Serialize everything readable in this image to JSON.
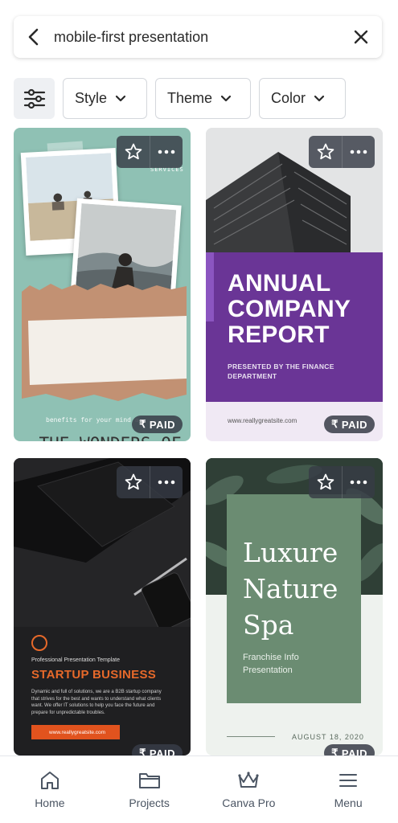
{
  "search": {
    "query": "mobile-first presentation"
  },
  "filters": {
    "chips": [
      {
        "label": "Style"
      },
      {
        "label": "Theme"
      },
      {
        "label": "Color"
      }
    ]
  },
  "templates": [
    {
      "title": "THE WONDERS OF MEDITATION",
      "subtitle": "benefits for your mind a",
      "corner_text": "SERVICES",
      "badge": "PAID",
      "currency": "₹",
      "bg_color": "#8fc1b4"
    },
    {
      "title_lines": [
        "ANNUAL",
        "COMPANY",
        "REPORT"
      ],
      "subtitle": "PRESENTED BY THE FINANCE DEPARTMENT",
      "site": "www.reallygreatsite.com",
      "badge": "PAID",
      "currency": "₹",
      "accent_color": "#6a3596"
    },
    {
      "kicker": "Professional Presentation Template",
      "title": "STARTUP BUSINESS",
      "body": "Dynamic and full of solutions, we are a B2B startup company that strives for the best and wants to understand what clients want. We offer IT solutions to help you face the future and prepare for unpredictable troubles.",
      "button_text": "www.reallygreatsite.com",
      "badge": "PAID",
      "currency": "₹",
      "accent_color": "#e6692a"
    },
    {
      "title_lines": [
        "Luxure",
        "Nature",
        "Spa"
      ],
      "subtitle_lines": [
        "Franchise Info",
        "Presentation"
      ],
      "date": "AUGUST 18, 2020",
      "badge": "PAID",
      "currency": "₹",
      "accent_color": "#6b8c72"
    }
  ],
  "bottom_nav": {
    "items": [
      {
        "label": "Home",
        "icon": "home-icon"
      },
      {
        "label": "Projects",
        "icon": "folder-icon"
      },
      {
        "label": "Canva Pro",
        "icon": "crown-icon"
      },
      {
        "label": "Menu",
        "icon": "menu-icon"
      }
    ]
  }
}
